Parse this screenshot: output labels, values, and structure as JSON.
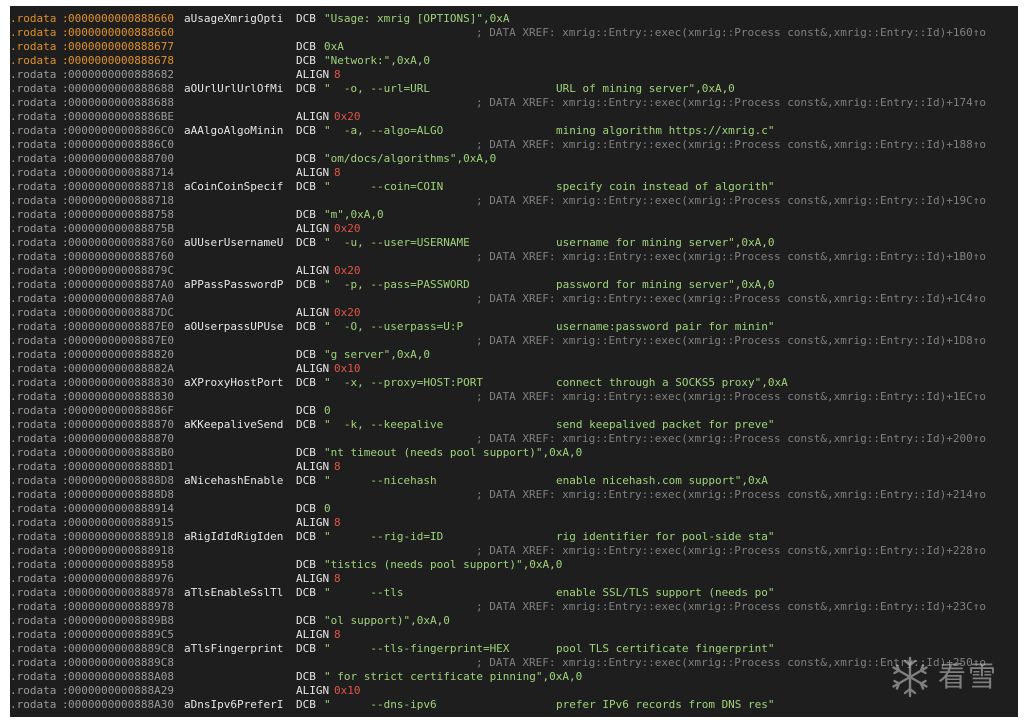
{
  "segment": ".rodata",
  "xref_prefix": "; DATA XREF: xmrig::Entry::exec(xmrig::Process const&,xmrig::Entry::Id)+",
  "watermark": {
    "text": "看雪",
    "icon": "snowflake-icon"
  },
  "colors": {
    "background": "#1e1e1e",
    "address": "#9a9a9a",
    "address_highlight": "#e0902c",
    "string": "#9fd27a",
    "align_value": "#e05545",
    "comment": "#7f7f7f"
  },
  "lines": [
    {
      "addr": "0000000000888660",
      "hl": true,
      "label": "aUsageXmrigOpti",
      "mnem": "DCB",
      "parts": [
        [
          "str",
          "\"Usage: xmrig [OPTIONS]\""
        ],
        [
          "num",
          ",0xA"
        ]
      ]
    },
    {
      "addr": "0000000000888660",
      "hl": true,
      "xref": "160↑o"
    },
    {
      "addr": "0000000000888677",
      "hl": true,
      "mnem": "DCB",
      "parts": [
        [
          "num",
          "0xA"
        ]
      ]
    },
    {
      "addr": "0000000000888678",
      "hl": true,
      "mnem": "DCB",
      "parts": [
        [
          "str",
          "\"Network:\""
        ],
        [
          "num",
          ",0xA,0"
        ]
      ]
    },
    {
      "addr": "0000000000888682",
      "mnem": "ALIGN",
      "parts": [
        [
          "al",
          "8"
        ]
      ]
    },
    {
      "addr": "0000000000888688",
      "label": "aOUrlUrlUrlOfMi",
      "mnem": "DCB",
      "parts": [
        [
          "str",
          "\"  -o, --url=URL"
        ]
      ],
      "str2": "URL of mining server\",0xA,0"
    },
    {
      "addr": "0000000000888688",
      "xref": "174↑o"
    },
    {
      "addr": "00000000008886BE",
      "mnem": "ALIGN",
      "parts": [
        [
          "al",
          "0x20"
        ]
      ]
    },
    {
      "addr": "00000000008886C0",
      "label": "aAAlgoAlgoMinin",
      "mnem": "DCB",
      "parts": [
        [
          "str",
          "\"  -a, --algo=ALGO"
        ]
      ],
      "str2": "mining algorithm https://xmrig.c\""
    },
    {
      "addr": "00000000008886C0",
      "xref": "188↑o"
    },
    {
      "addr": "0000000000888700",
      "mnem": "DCB",
      "parts": [
        [
          "str",
          "\"om/docs/algorithms\""
        ],
        [
          "num",
          ",0xA,0"
        ]
      ]
    },
    {
      "addr": "0000000000888714",
      "mnem": "ALIGN",
      "parts": [
        [
          "al",
          "8"
        ]
      ]
    },
    {
      "addr": "0000000000888718",
      "label": "aCoinCoinSpecif",
      "mnem": "DCB",
      "parts": [
        [
          "str",
          "\"      --coin=COIN"
        ]
      ],
      "str2": "specify coin instead of algorith\""
    },
    {
      "addr": "0000000000888718",
      "xref": "19C↑o"
    },
    {
      "addr": "0000000000888758",
      "mnem": "DCB",
      "parts": [
        [
          "str",
          "\"m\""
        ],
        [
          "num",
          ",0xA,0"
        ]
      ]
    },
    {
      "addr": "000000000088875B",
      "mnem": "ALIGN",
      "parts": [
        [
          "al",
          "0x20"
        ]
      ]
    },
    {
      "addr": "0000000000888760",
      "label": "aUUserUsernameU",
      "mnem": "DCB",
      "parts": [
        [
          "str",
          "\"  -u, --user=USERNAME"
        ]
      ],
      "str2": "username for mining server\",0xA,0"
    },
    {
      "addr": "0000000000888760",
      "xref": "1B0↑o"
    },
    {
      "addr": "000000000088879C",
      "mnem": "ALIGN",
      "parts": [
        [
          "al",
          "0x20"
        ]
      ]
    },
    {
      "addr": "00000000008887A0",
      "label": "aPPassPasswordP",
      "mnem": "DCB",
      "parts": [
        [
          "str",
          "\"  -p, --pass=PASSWORD"
        ]
      ],
      "str2": "password for mining server\",0xA,0"
    },
    {
      "addr": "00000000008887A0",
      "xref": "1C4↑o"
    },
    {
      "addr": "00000000008887DC",
      "mnem": "ALIGN",
      "parts": [
        [
          "al",
          "0x20"
        ]
      ]
    },
    {
      "addr": "00000000008887E0",
      "label": "aOUserpassUPUse",
      "mnem": "DCB",
      "parts": [
        [
          "str",
          "\"  -O, --userpass=U:P"
        ]
      ],
      "str2": "username:password pair for minin\""
    },
    {
      "addr": "00000000008887E0",
      "xref": "1D8↑o"
    },
    {
      "addr": "0000000000888820",
      "mnem": "DCB",
      "parts": [
        [
          "str",
          "\"g server\""
        ],
        [
          "num",
          ",0xA,0"
        ]
      ]
    },
    {
      "addr": "000000000088882A",
      "mnem": "ALIGN",
      "parts": [
        [
          "al",
          "0x10"
        ]
      ]
    },
    {
      "addr": "0000000000888830",
      "label": "aXProxyHostPort",
      "mnem": "DCB",
      "parts": [
        [
          "str",
          "\"  -x, --proxy=HOST:PORT"
        ]
      ],
      "str2": "connect through a SOCKS5 proxy\",0xA"
    },
    {
      "addr": "0000000000888830",
      "xref": "1EC↑o"
    },
    {
      "addr": "000000000088886F",
      "mnem": "DCB",
      "parts": [
        [
          "num",
          "0"
        ]
      ]
    },
    {
      "addr": "0000000000888870",
      "label": "aKKeepaliveSend",
      "mnem": "DCB",
      "parts": [
        [
          "str",
          "\"  -k, --keepalive"
        ]
      ],
      "str2": "send keepalived packet for preve\""
    },
    {
      "addr": "0000000000888870",
      "xref": "200↑o"
    },
    {
      "addr": "00000000008888B0",
      "mnem": "DCB",
      "parts": [
        [
          "str",
          "\"nt timeout (needs pool support)\""
        ],
        [
          "num",
          ",0xA,0"
        ]
      ]
    },
    {
      "addr": "00000000008888D1",
      "mnem": "ALIGN",
      "parts": [
        [
          "al",
          "8"
        ]
      ]
    },
    {
      "addr": "00000000008888D8",
      "label": "aNicehashEnable",
      "mnem": "DCB",
      "parts": [
        [
          "str",
          "\"      --nicehash"
        ]
      ],
      "str2": "enable nicehash.com support\",0xA"
    },
    {
      "addr": "00000000008888D8",
      "xref": "214↑o"
    },
    {
      "addr": "0000000000888914",
      "mnem": "DCB",
      "parts": [
        [
          "num",
          "0"
        ]
      ]
    },
    {
      "addr": "0000000000888915",
      "mnem": "ALIGN",
      "parts": [
        [
          "al",
          "8"
        ]
      ]
    },
    {
      "addr": "0000000000888918",
      "label": "aRigIdIdRigIden",
      "mnem": "DCB",
      "parts": [
        [
          "str",
          "\"      --rig-id=ID"
        ]
      ],
      "str2": "rig identifier for pool-side sta\""
    },
    {
      "addr": "0000000000888918",
      "xref": "228↑o"
    },
    {
      "addr": "0000000000888958",
      "mnem": "DCB",
      "parts": [
        [
          "str",
          "\"tistics (needs pool support)\""
        ],
        [
          "num",
          ",0xA,0"
        ]
      ]
    },
    {
      "addr": "0000000000888976",
      "mnem": "ALIGN",
      "parts": [
        [
          "al",
          "8"
        ]
      ]
    },
    {
      "addr": "0000000000888978",
      "label": "aTlsEnableSslTl",
      "mnem": "DCB",
      "parts": [
        [
          "str",
          "\"      --tls"
        ]
      ],
      "str2": "enable SSL/TLS support (needs po\""
    },
    {
      "addr": "0000000000888978",
      "xref": "23C↑o"
    },
    {
      "addr": "00000000008889B8",
      "mnem": "DCB",
      "parts": [
        [
          "str",
          "\"ol support)\""
        ],
        [
          "num",
          ",0xA,0"
        ]
      ]
    },
    {
      "addr": "00000000008889C5",
      "mnem": "ALIGN",
      "parts": [
        [
          "al",
          "8"
        ]
      ]
    },
    {
      "addr": "00000000008889C8",
      "label": "aTlsFingerprint",
      "mnem": "DCB",
      "parts": [
        [
          "str",
          "\"      --tls-fingerprint=HEX"
        ]
      ],
      "str2": "pool TLS certificate fingerprint\""
    },
    {
      "addr": "00000000008889C8",
      "xref": "250↑o"
    },
    {
      "addr": "0000000000888A08",
      "mnem": "DCB",
      "parts": [
        [
          "str",
          "\" for strict certificate pinning\""
        ],
        [
          "num",
          ",0xA,0"
        ]
      ]
    },
    {
      "addr": "0000000000888A29",
      "mnem": "ALIGN",
      "parts": [
        [
          "al",
          "0x10"
        ]
      ]
    },
    {
      "addr": "0000000000888A30",
      "label": "aDnsIpv6PreferI",
      "mnem": "DCB",
      "parts": [
        [
          "str",
          "\"      --dns-ipv6"
        ]
      ],
      "str2": "prefer IPv6 records from DNS res\""
    }
  ]
}
